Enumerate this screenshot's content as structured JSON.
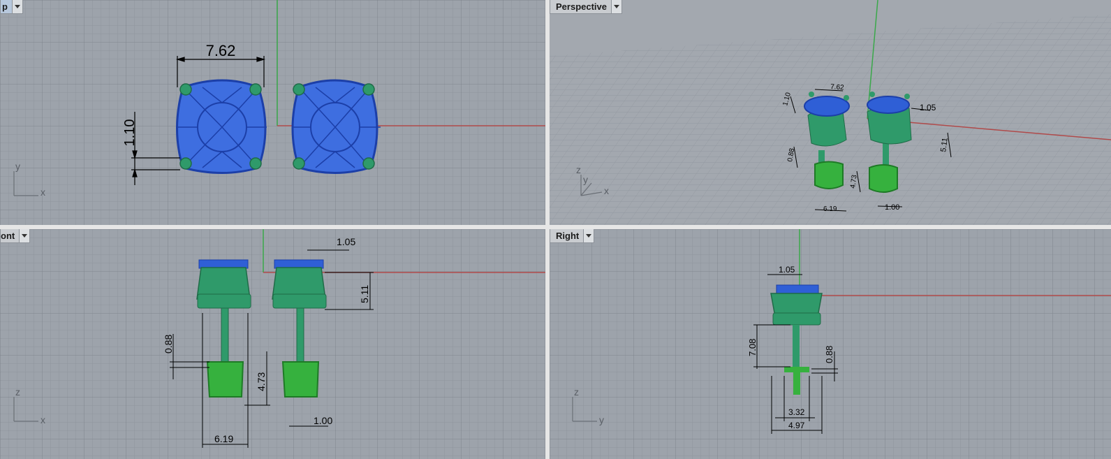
{
  "viewports": {
    "top": {
      "label": "Top",
      "label_visible": "p",
      "axis_a": "y",
      "axis_b": "x"
    },
    "perspective": {
      "label": "Perspective",
      "axis_a": "z",
      "axis_b": "y",
      "axis_c": "x"
    },
    "front": {
      "label": "Front",
      "label_visible": "ont",
      "axis_a": "z",
      "axis_b": "x"
    },
    "right": {
      "label": "Right",
      "axis_a": "z",
      "axis_b": "y"
    }
  },
  "dimensions": {
    "top": {
      "width": "7.62",
      "height": "1.10"
    },
    "perspective": {
      "d1": "7.62",
      "d2": "1.10",
      "d3": "1.05",
      "d4": "5.11",
      "d5": "0.88",
      "d6": "4.73",
      "d7": "6.19",
      "d8": "1.00"
    },
    "front": {
      "d1": "1.05",
      "d2": "5.11",
      "d3": "0.88",
      "d4": "4.73",
      "d5": "6.19",
      "d6": "1.00"
    },
    "right": {
      "d1": "1.05",
      "d2": "7.08",
      "d3": "0.88",
      "d4": "3.32",
      "d5": "4.97"
    }
  },
  "colors": {
    "gem": "#2f5fd6",
    "metal": "#2f9a6a",
    "screw": "#2fa63a",
    "grid_bg": "#9da3ab",
    "x_axis": "#b04a4a",
    "y_axis": "#3aa84a"
  }
}
